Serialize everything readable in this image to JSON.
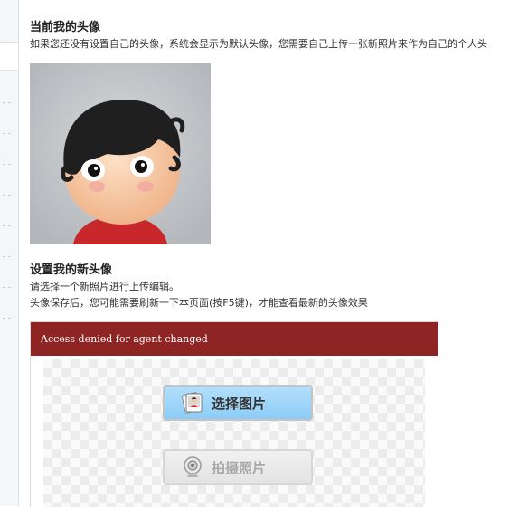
{
  "current_avatar": {
    "title": "当前我的头像",
    "description": "如果您还没有设置自己的头像，系统会显示为默认头像，您需要自己上传一张新照片来作为自己的个人头"
  },
  "new_avatar": {
    "title": "设置我的新头像",
    "line1": "请选择一个新照片进行上传编辑。",
    "line2": "头像保存后，您可能需要刷新一下本页面(按F5键)，才能查看最新的头像效果"
  },
  "upload_panel": {
    "header_text": "Access denied for agent changed",
    "select_button_label": "选择图片",
    "camera_button_label": "拍摄照片"
  },
  "colors": {
    "panel_header": "#8f2424",
    "select_button": "#a3d8fa"
  },
  "icons": {
    "select": "photo-icon",
    "camera": "webcam-icon"
  }
}
